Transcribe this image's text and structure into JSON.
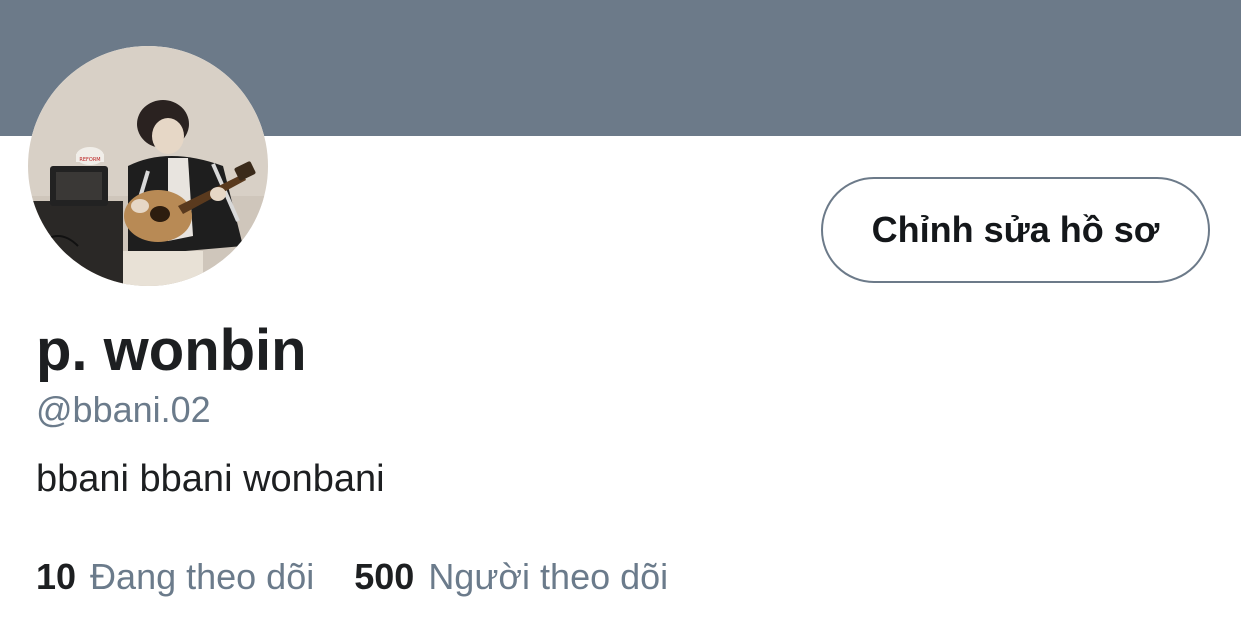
{
  "profile": {
    "display_name": "p. wonbin",
    "handle": "@bbani.02",
    "bio": "bbani bbani wonbani",
    "edit_button_label": "Chỉnh sửa hồ sơ"
  },
  "stats": {
    "following_count": "10",
    "following_label": "Đang theo dõi",
    "followers_count": "500",
    "followers_label": "Người theo dõi"
  },
  "colors": {
    "banner": "#6c7a89",
    "secondary_text": "#6b7b8b",
    "primary_text": "#1d1f21"
  },
  "avatar": {
    "icon": "profile-photo-person-playing-guitar",
    "cap_text": "REFORM"
  }
}
